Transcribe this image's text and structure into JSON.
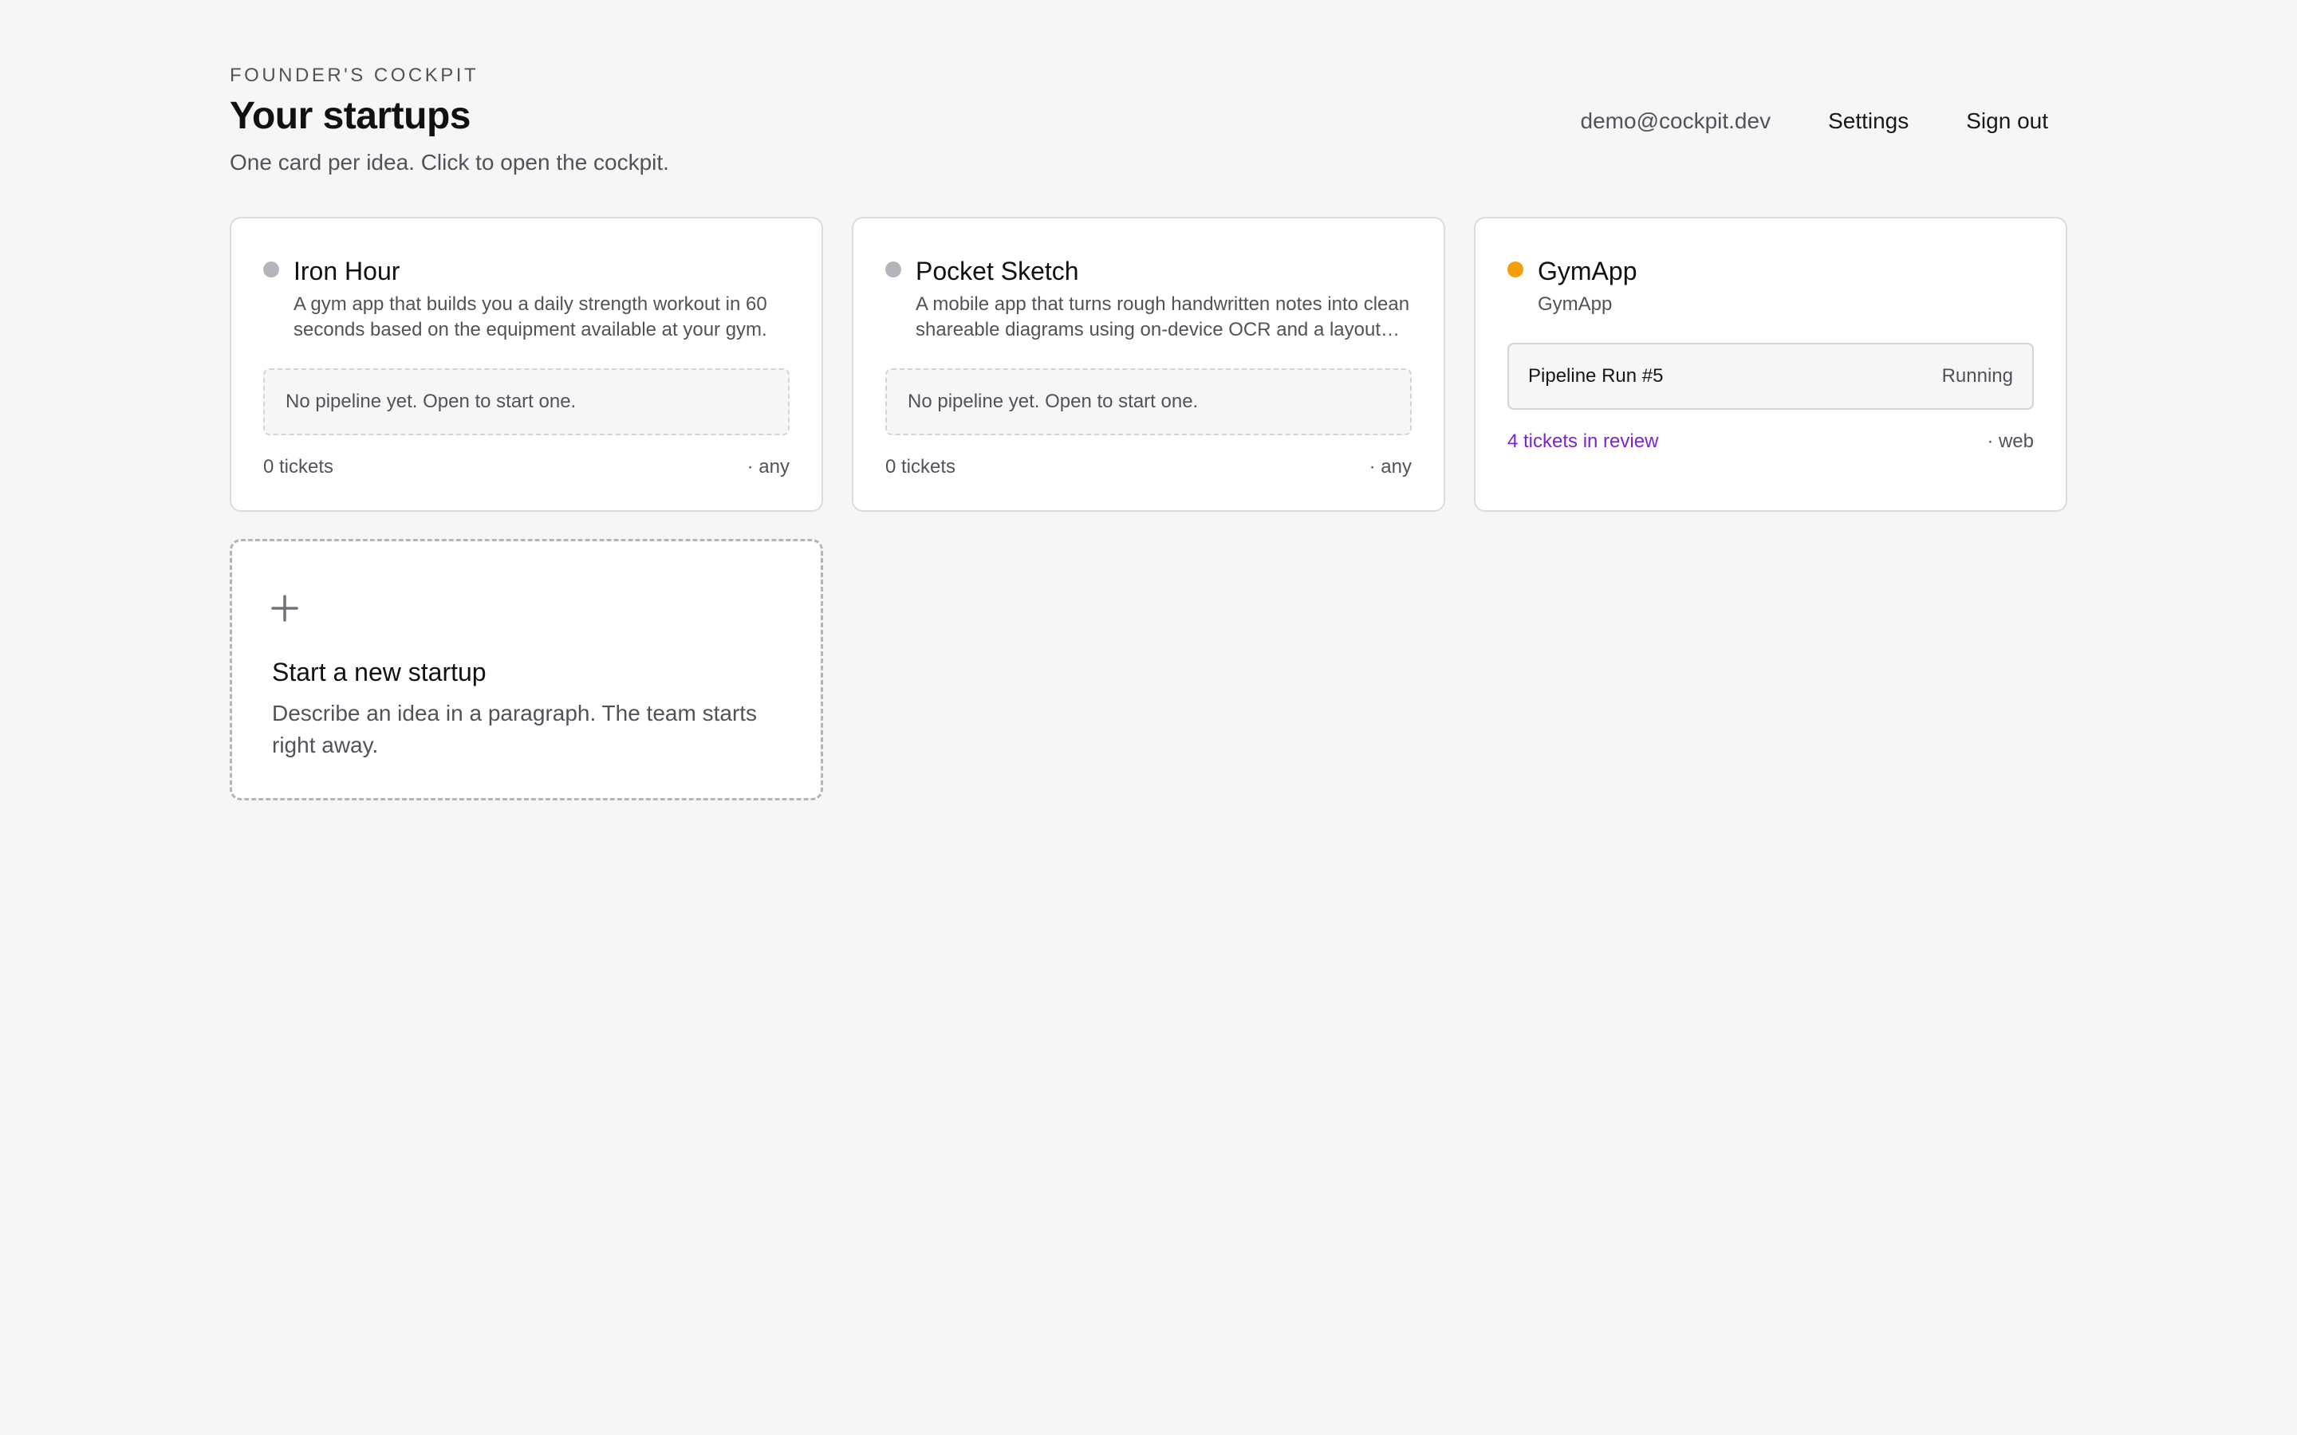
{
  "header": {
    "eyebrow": "FOUNDER'S COCKPIT",
    "title": "Your startups",
    "subtitle": "One card per idea. Click to open the cockpit."
  },
  "nav": {
    "email": "demo@cockpit.dev",
    "settings_label": "Settings",
    "signout_label": "Sign out"
  },
  "colors": {
    "idle_dot": "#b4b4bd",
    "running_dot": "#f59e0b",
    "review_link": "#7e22ce"
  },
  "cards": [
    {
      "name": "Iron Hour",
      "status": "idle",
      "description": "A gym app that builds you a daily strength workout in 60 seconds based on the equipment available at your gym.",
      "pipeline_empty": "No pipeline yet. Open to start one.",
      "tickets": "0 tickets",
      "platform": "· any"
    },
    {
      "name": "Pocket Sketch",
      "status": "idle",
      "description": "A mobile app that turns rough handwritten notes into clean shareable diagrams using on-device OCR and a layout engine.",
      "pipeline_empty": "No pipeline yet. Open to start one.",
      "tickets": "0 tickets",
      "platform": "· any"
    },
    {
      "name": "GymApp",
      "status": "running",
      "subname": "GymApp",
      "pipeline_run": "Pipeline Run #5",
      "pipeline_status": "Running",
      "tickets": "4 tickets in review",
      "platform": "· web"
    }
  ],
  "new_startup": {
    "icon": "plus-icon",
    "title": "Start a new startup",
    "description": "Describe an idea in a paragraph. The team starts right away."
  }
}
